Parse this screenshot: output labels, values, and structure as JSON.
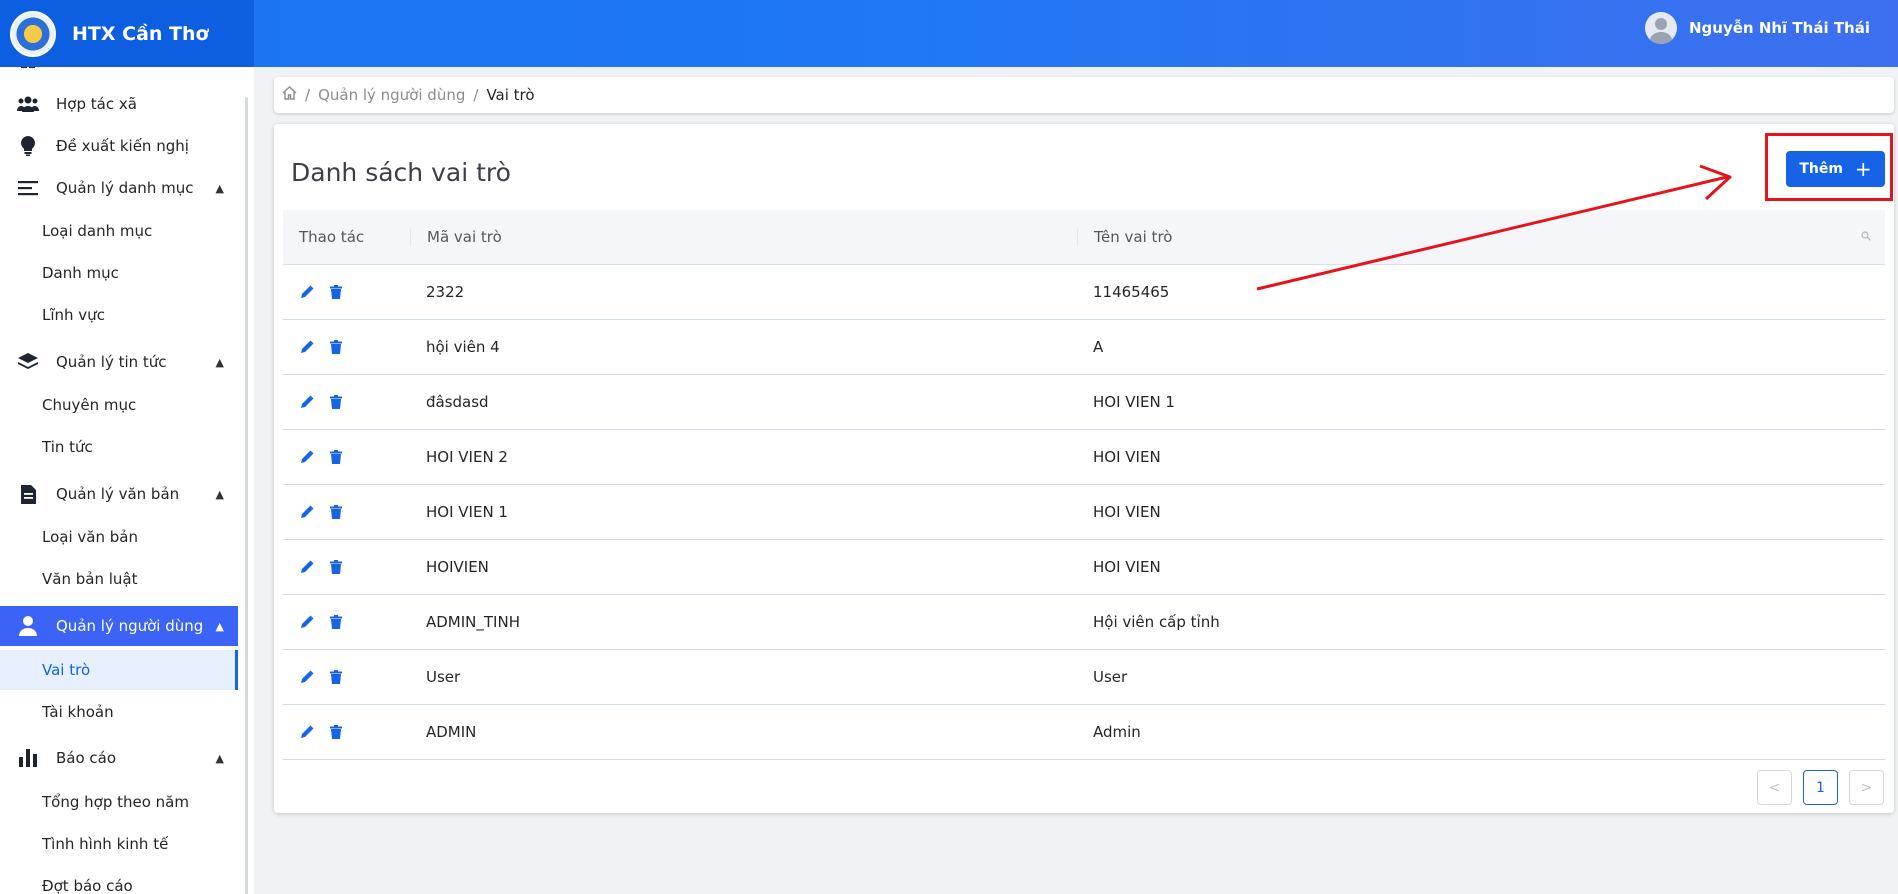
{
  "header": {
    "brand_name": "HTX Cần Thơ",
    "user_name": "Nguyễn Nhĩ Thái Thái"
  },
  "sidebar": {
    "items": [
      {
        "label": "Hợp tác xã",
        "icon": "users-icon"
      },
      {
        "label": "Đề xuất kiến nghị",
        "icon": "lightbulb-icon"
      },
      {
        "label": "Quản lý danh mục",
        "icon": "list-icon"
      },
      {
        "label": "Loại danh mục"
      },
      {
        "label": "Danh mục"
      },
      {
        "label": "Lĩnh vực"
      },
      {
        "label": "Quản lý tin tức",
        "icon": "layers-icon"
      },
      {
        "label": "Chuyên mục"
      },
      {
        "label": "Tin tức"
      },
      {
        "label": "Quản lý văn bản",
        "icon": "document-icon"
      },
      {
        "label": "Loại văn bản"
      },
      {
        "label": "Văn bản luật"
      },
      {
        "label": "Quản lý người dùng",
        "icon": "user-icon"
      },
      {
        "label": "Vai trò"
      },
      {
        "label": "Tài khoản"
      },
      {
        "label": "Báo cáo",
        "icon": "bar-chart-icon"
      },
      {
        "label": "Tổng hợp theo năm"
      },
      {
        "label": "Tình hình kinh tế"
      },
      {
        "label": "Đợt báo cáo"
      }
    ]
  },
  "breadcrumb": {
    "level1": "Quản lý người dùng",
    "level2": "Vai trò"
  },
  "main": {
    "title": "Danh sách vai trò",
    "add_label": "Thêm",
    "columns": [
      "Thao tác",
      "Mã vai trò",
      "Tên vai trò"
    ],
    "rows": [
      {
        "code": "2322",
        "name": "11465465"
      },
      {
        "code": "hội viên 4",
        "name": "A"
      },
      {
        "code": "đâsdasd",
        "name": "HOI VIEN 1"
      },
      {
        "code": "HOI VIEN 2",
        "name": "HOI VIEN"
      },
      {
        "code": "HOI VIEN 1",
        "name": "HOI VIEN"
      },
      {
        "code": "HOIVIEN",
        "name": "HOI VIEN"
      },
      {
        "code": "ADMIN_TINH",
        "name": "Hội viên cấp tỉnh"
      },
      {
        "code": "User",
        "name": "User"
      },
      {
        "code": "ADMIN",
        "name": "Admin"
      }
    ],
    "pagination": {
      "current_page": "1",
      "prev": "<",
      "next": ">"
    }
  },
  "colors": {
    "primary": "#1663e8",
    "annotation": "#e6131b"
  }
}
